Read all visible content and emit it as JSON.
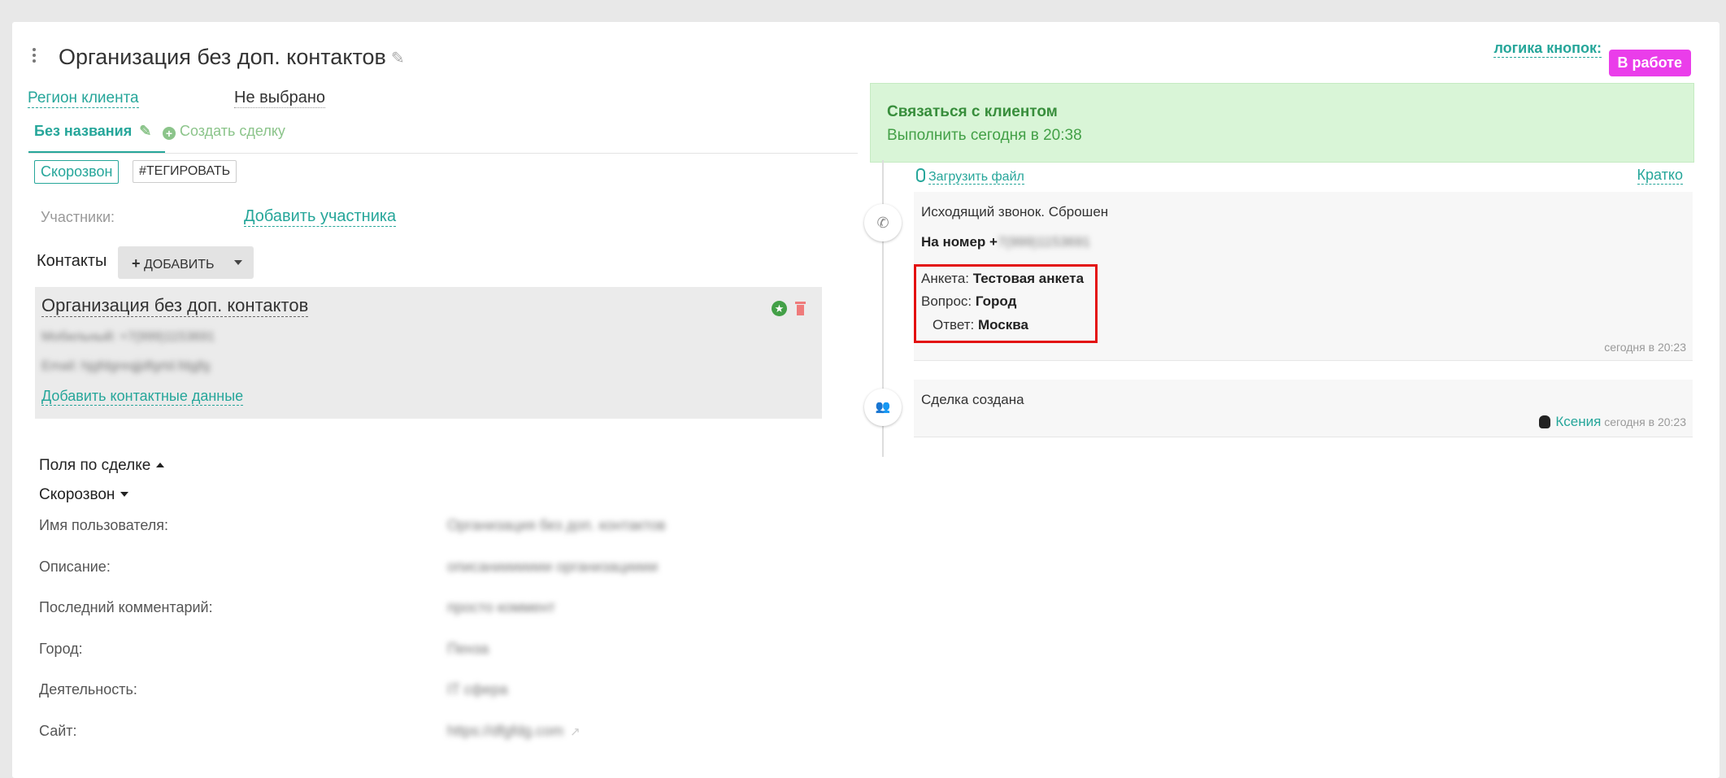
{
  "header": {
    "title": "Организация без доп. контактов",
    "logic_label": "логика кнопок:",
    "status": "В работе"
  },
  "left": {
    "region_label": "Регион клиента",
    "region_value": "Не выбрано",
    "tab_active": "Без названия",
    "create_deal": "Создать сделку",
    "tag_skorozvon": "Скорозвон",
    "tag_button": "#ТЕГИРОВАТЬ",
    "participants_label": "Участники:",
    "add_participant": "Добавить участника",
    "contacts_title": "Контакты",
    "add_button": "ДОБАВИТЬ",
    "contact": {
      "name": "Организация без доп. контактов",
      "line1": "Мобильный: +7(999)1153691",
      "line2": "Email: hjgfdgreqjjdfgrtd.fdgjfg",
      "add_data": "Добавить контактные данные"
    },
    "deal_fields": "Поля по сделке",
    "skorozvon_section": "Скорозвон",
    "fields": [
      {
        "label": "Имя пользователя:",
        "value": "Организация без доп. контактов"
      },
      {
        "label": "Описание:",
        "value": "описаниииииии организацииии"
      },
      {
        "label": "Последний комментарий:",
        "value": "просто коммент"
      },
      {
        "label": "Город:",
        "value": "Пенза"
      },
      {
        "label": "Деятельность:",
        "value": "IT сфера"
      },
      {
        "label": "Сайт:",
        "value": "https://dfgfdg.com"
      }
    ]
  },
  "right": {
    "task_title": "Связаться с клиентом",
    "task_due": "Выполнить сегодня в 20:38",
    "upload_file": "Загрузить файл",
    "kratko": "Кратко",
    "event1": {
      "title": "Исходящий звонок. Сброшен",
      "number_label": "На номер +",
      "number_value": "7(999)1153691",
      "anketa_label": "Анкета:",
      "anketa_value": "Тестовая анкета",
      "question_label": "Вопрос:",
      "question_value": "Город",
      "answer_label": "Ответ:",
      "answer_value": "Москва",
      "time": "сегодня в 20:23"
    },
    "event2": {
      "title": "Сделка создана",
      "author": "Ксения",
      "time": "сегодня в 20:23"
    }
  }
}
